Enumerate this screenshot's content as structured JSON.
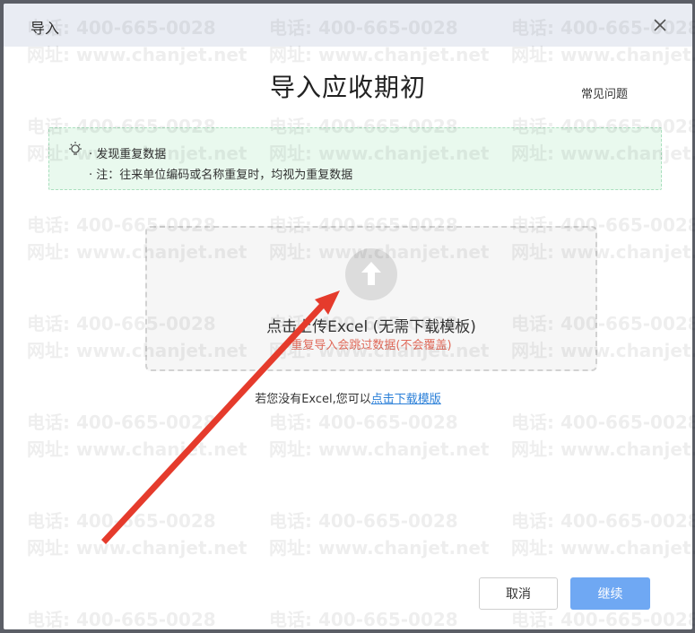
{
  "dialog": {
    "title": "导入",
    "heading": "导入应收期初",
    "faq_label": "常见问题",
    "notice": {
      "line1": "· 发现重复数据",
      "line2": "· 注：往来单位编码或名称重复时，均视为重复数据"
    },
    "upload": {
      "main_text": "点击上传Excel (无需下载模板)",
      "note": "重复导入会跳过数据(不会覆盖)"
    },
    "template": {
      "prefix": "若您没有Excel,您可以",
      "link": "点击下载模版"
    },
    "buttons": {
      "cancel": "取消",
      "continue": "继续"
    }
  },
  "watermark": {
    "phone": "电话: 400-665-0028",
    "site": "网址: www.chanjet.net"
  },
  "colors": {
    "titlebar": "#e9ecf3",
    "notice_bg": "#e9f9ee",
    "notice_border": "#a9dfbe",
    "primary_button": "#6fa8f3",
    "link": "#2a7fd8",
    "warning_text": "#e06a5a",
    "annotation_arrow": "#e53b2c"
  },
  "icons": {
    "close": "close-icon",
    "bulb": "lightbulb-icon",
    "upload": "upload-arrow-icon"
  }
}
